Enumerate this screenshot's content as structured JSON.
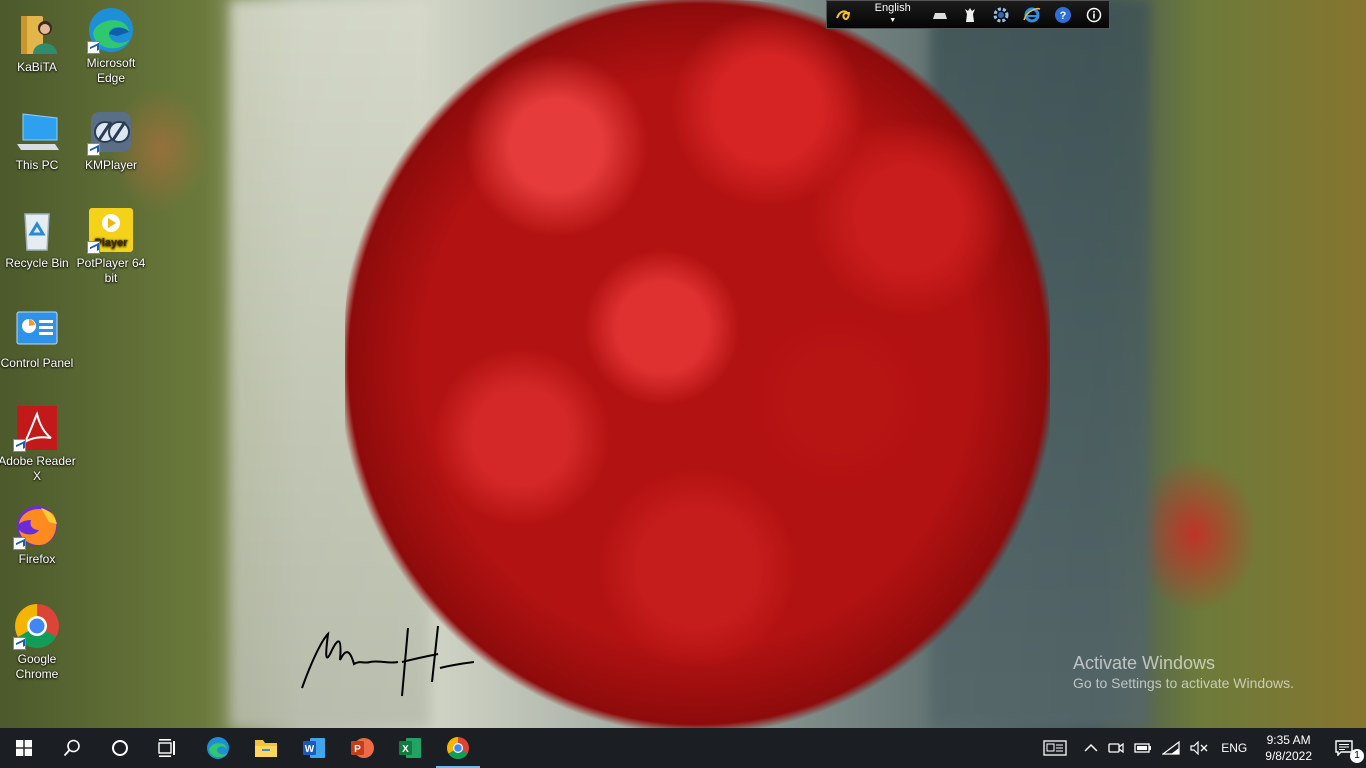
{
  "desktop": {
    "icons": [
      {
        "label": "KaBiTA",
        "icon": "user-folder-icon"
      },
      {
        "label": "Microsoft Edge",
        "icon": "edge-icon"
      },
      {
        "label": "This PC",
        "icon": "this-pc-icon"
      },
      {
        "label": "KMPlayer",
        "icon": "kmplayer-icon"
      },
      {
        "label": "Recycle Bin",
        "icon": "recycle-bin-icon"
      },
      {
        "label": "PotPlayer 64 bit",
        "icon": "potplayer-icon"
      },
      {
        "label": "Control Panel",
        "icon": "control-panel-icon"
      },
      {
        "label": "Adobe Reader X",
        "icon": "adobe-reader-icon"
      },
      {
        "label": "Firefox",
        "icon": "firefox-icon"
      },
      {
        "label": "Google Chrome",
        "icon": "chrome-icon"
      }
    ],
    "potplayer_tile_text": "Player",
    "signature_text": "Mizanur Hossain"
  },
  "language_bar": {
    "language": "English",
    "icons": [
      "avro-logo-icon",
      "keyboard-icon",
      "layout-icon",
      "settings-icon",
      "internet-explorer-icon",
      "help-icon",
      "info-icon"
    ]
  },
  "watermark": {
    "title": "Activate Windows",
    "subtitle": "Go to Settings to activate Windows."
  },
  "taskbar": {
    "apps": [
      "start-icon",
      "search-icon",
      "cortana-icon",
      "task-view-icon",
      "edge-icon",
      "file-explorer-icon",
      "word-icon",
      "powerpoint-icon",
      "excel-icon",
      "chrome-icon"
    ],
    "tray": {
      "input_indicator": "ENG",
      "time": "9:35 AM",
      "date": "9/8/2022",
      "notification_count": "1"
    }
  },
  "colors": {
    "taskbar_bg": "#1b1f24",
    "active_indicator": "#76b9ed",
    "langbar_bg": "#0b0b0b"
  }
}
